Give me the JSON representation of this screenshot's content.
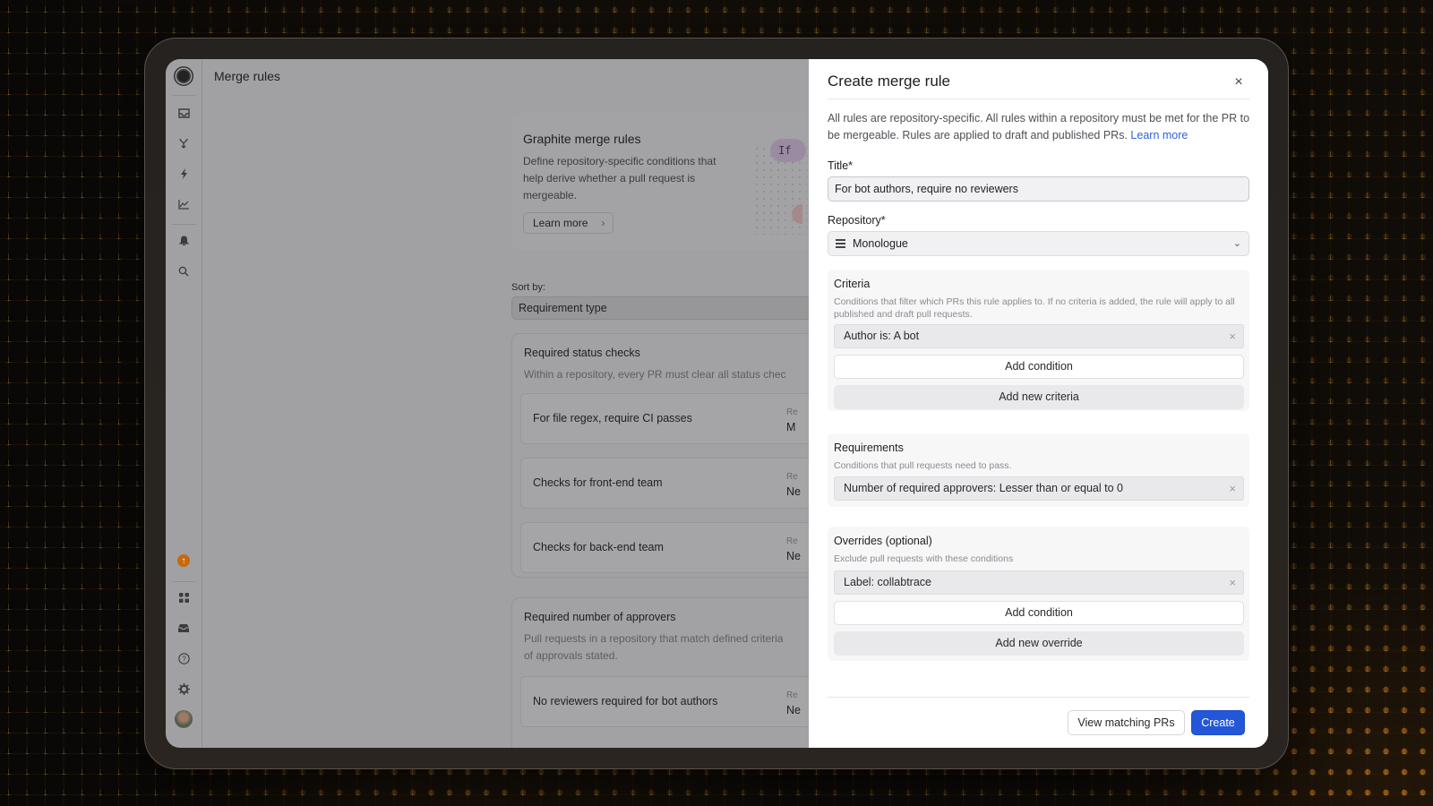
{
  "app": {
    "page_title": "Merge rules"
  },
  "sidebar": {
    "top_items": [
      {
        "icon": "graphite-logo-icon"
      },
      {
        "icon": "inbox-icon"
      },
      {
        "icon": "merge-icon"
      },
      {
        "icon": "lightning-icon"
      },
      {
        "icon": "chart-icon"
      },
      {
        "icon": "bell-icon"
      },
      {
        "icon": "search-icon"
      }
    ],
    "bottom_items": [
      {
        "icon": "upgrade-arrow-icon",
        "glyph": "↑"
      },
      {
        "icon": "apps-grid-icon"
      },
      {
        "icon": "tray-icon"
      },
      {
        "icon": "help-icon",
        "glyph": "?"
      },
      {
        "icon": "gear-icon",
        "glyph": "⚙"
      },
      {
        "icon": "user-avatar"
      }
    ]
  },
  "hero": {
    "title": "Graphite merge rules",
    "description": "Define repository-specific conditions that help derive whether a pull request is mergeable.",
    "learn_more": "Learn more",
    "chevron": "›",
    "if_pill": "If"
  },
  "sort": {
    "label": "Sort by:",
    "value": "Requirement type"
  },
  "groups": [
    {
      "title": "Required status checks",
      "description": "Within a repository, every PR must clear all status chec",
      "rules": [
        {
          "name": "For file regex, require CI passes",
          "meta_key": "Re",
          "meta_value": "M"
        },
        {
          "name": "Checks for front-end team",
          "meta_key": "Re",
          "meta_value": "Ne"
        },
        {
          "name": "Checks for back-end team",
          "meta_key": "Re",
          "meta_value": "Ne"
        }
      ]
    },
    {
      "title": "Required number of approvers",
      "description": "Pull requests in a repository that match defined criteria",
      "description_line2": "of approvals stated.",
      "rules": [
        {
          "name": "No reviewers required for bot authors",
          "meta_key": "Re",
          "meta_value": "Ne"
        }
      ]
    }
  ],
  "modal": {
    "title": "Create merge rule",
    "close_glyph": "×",
    "intro": "All rules are repository-specific. All rules within a repository must be met for the PR to be mergeable. Rules are applied to draft and published PRs.",
    "intro_link": "Learn more",
    "title_label": "Title*",
    "title_value": "For bot authors, require no reviewers",
    "repository_label": "Repository*",
    "repository_value": "Monologue",
    "repository_chevron": "⌄",
    "criteria": {
      "title": "Criteria",
      "description": "Conditions that filter which PRs this rule applies to. If no criteria is added, the rule will apply to all published and draft pull requests.",
      "conditions": [
        "Author is: A bot"
      ],
      "add_condition": "Add condition",
      "add_new": "Add new criteria"
    },
    "requirements": {
      "title": "Requirements",
      "description": "Conditions that pull requests need to pass.",
      "conditions": [
        "Number of required approvers: Lesser than or equal to 0"
      ]
    },
    "overrides": {
      "title": "Overrides (optional)",
      "description": "Exclude pull requests with these conditions",
      "conditions": [
        "Label: collabtrace"
      ],
      "add_condition": "Add condition",
      "add_new": "Add new override"
    },
    "remove_glyph": "×",
    "view_matching": "View matching PRs",
    "create": "Create"
  },
  "colors": {
    "primary": "#2357d8",
    "link": "#2f63d6",
    "upgrade": "#c56a0c"
  }
}
